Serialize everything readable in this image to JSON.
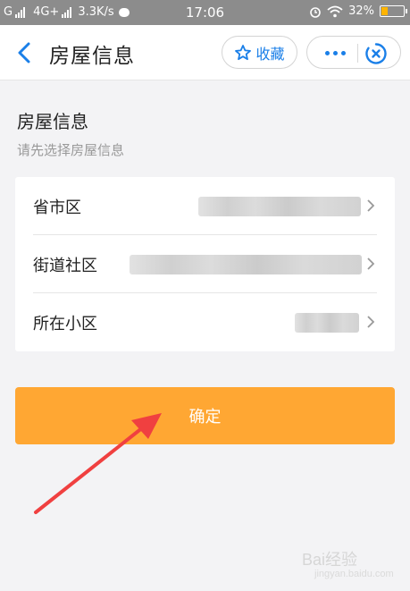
{
  "status_bar": {
    "carrier_g": "G",
    "network": "4G+",
    "speed": "3.3K/s",
    "time": "17:06",
    "battery_percent": "32%",
    "battery_level": 0.32
  },
  "header": {
    "title": "房屋信息",
    "favorite_label": "收藏",
    "icons": {
      "back": "chevron-left-icon",
      "favorite": "star-icon",
      "more": "more-dots-icon",
      "close": "close-circle-icon"
    },
    "accent_color": "#1a7fe8"
  },
  "section": {
    "title": "房屋信息",
    "subtitle": "请先选择房屋信息"
  },
  "form_rows": [
    {
      "label": "省市区"
    },
    {
      "label": "街道社区"
    },
    {
      "label": "所在小区"
    }
  ],
  "confirm_button": {
    "label": "确定",
    "color": "#ffa733"
  },
  "watermark": {
    "text": "Bai经验",
    "sub": "jingyan.baidu.com"
  }
}
